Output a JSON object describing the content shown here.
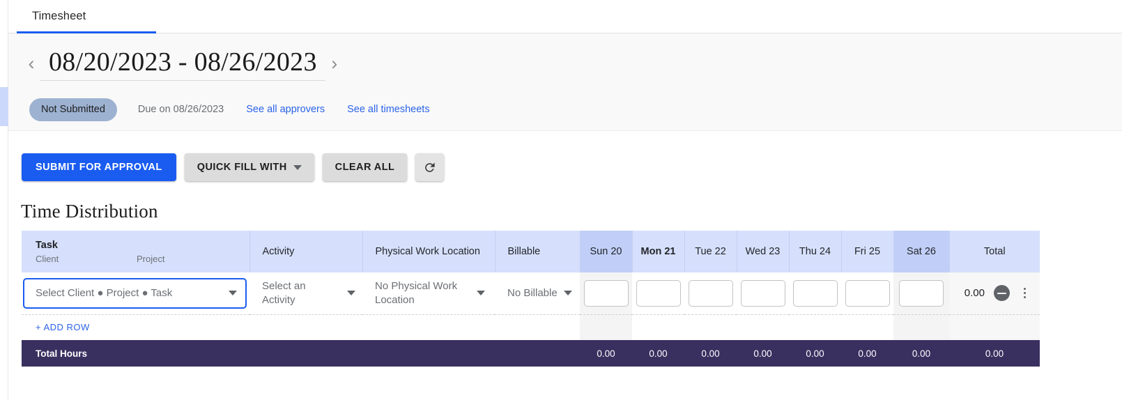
{
  "rail": {
    "active_item_name": "timesheet-rail-item"
  },
  "tabs": [
    {
      "label": "Timesheet",
      "active": true
    }
  ],
  "header": {
    "prev_icon": "chevron-left-icon",
    "next_icon": "chevron-right-icon",
    "date_range": "08/20/2023 - 08/26/2023",
    "status_label": "Not Submitted",
    "due_text": "Due on 08/26/2023",
    "links": [
      {
        "label": "See all approvers"
      },
      {
        "label": "See all timesheets"
      }
    ]
  },
  "toolbar": {
    "submit_label": "SUBMIT FOR APPROVAL",
    "quick_fill_label": "QUICK FILL WITH",
    "clear_all_label": "CLEAR ALL",
    "refresh_icon": "refresh-icon"
  },
  "section": {
    "title": "Time Distribution"
  },
  "table": {
    "headers": {
      "task": "Task",
      "task_client": "Client",
      "task_project": "Project",
      "activity": "Activity",
      "physical_work_location": "Physical Work Location",
      "billable": "Billable",
      "total": "Total"
    },
    "days": [
      {
        "label": "Sun 20",
        "weekend": true,
        "active": false
      },
      {
        "label": "Mon 21",
        "weekend": false,
        "active": true
      },
      {
        "label": "Tue 22",
        "weekend": false,
        "active": false
      },
      {
        "label": "Wed 23",
        "weekend": false,
        "active": false
      },
      {
        "label": "Thu 24",
        "weekend": false,
        "active": false
      },
      {
        "label": "Fri 25",
        "weekend": false,
        "active": false
      },
      {
        "label": "Sat 26",
        "weekend": true,
        "active": false
      }
    ],
    "row": {
      "task_value": "Select Client ● Project ● Task",
      "activity_value": "Select an Activity",
      "location_value": "No Physical Work Location",
      "billable_value": "No Billable",
      "hours": [
        "",
        "",
        "",
        "",
        "",
        "",
        ""
      ],
      "hours_placeholder": "",
      "row_total": "0.00",
      "remove_icon": "remove-circle-icon",
      "menu_icon": "kebab-menu-icon"
    },
    "add_row_label": "+ ADD ROW",
    "footer": {
      "label": "Total Hours",
      "day_totals": [
        "0.00",
        "0.00",
        "0.00",
        "0.00",
        "0.00",
        "0.00",
        "0.00"
      ],
      "grand_total": "0.00"
    }
  },
  "colors": {
    "accent_blue": "#1a5cf0",
    "link_blue": "#2a63e8",
    "header_blue": "#d6e0fc",
    "weekend_blue": "#c1cff8",
    "totals_purple": "#3a3060",
    "status_chip": "#9db2d1"
  }
}
